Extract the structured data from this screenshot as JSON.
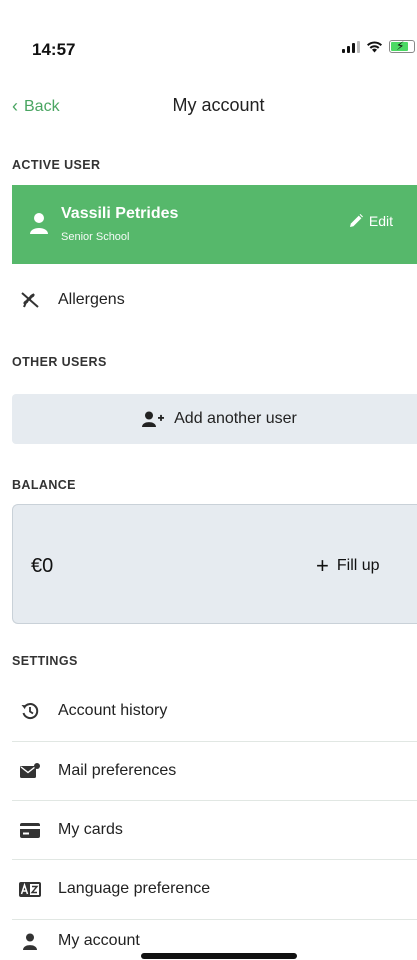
{
  "status_bar": {
    "time": "14:57"
  },
  "nav": {
    "back_label": "Back",
    "title": "My account"
  },
  "active_user_section": {
    "label": "ACTIVE USER",
    "name": "Vassili Petrides",
    "school": "Senior School",
    "edit_label": "Edit",
    "color": "#56b86b"
  },
  "allergens": {
    "label": "Allergens"
  },
  "other_users_section": {
    "label": "OTHER USERS",
    "add_label": "Add another user"
  },
  "balance_section": {
    "label": "BALANCE",
    "amount": "€0",
    "fill_up_label": "Fill up"
  },
  "settings_section": {
    "label": "SETTINGS",
    "items": [
      {
        "label": "Account history",
        "icon": "history-icon"
      },
      {
        "label": "Mail preferences",
        "icon": "mail-icon"
      },
      {
        "label": "My cards",
        "icon": "card-icon"
      },
      {
        "label": "Language preference",
        "icon": "language-icon"
      },
      {
        "label": "My account",
        "icon": "person-icon"
      }
    ]
  },
  "colors": {
    "accent": "#4aa562",
    "panel": "#e6ebf0",
    "active_bg": "#56b86b"
  }
}
